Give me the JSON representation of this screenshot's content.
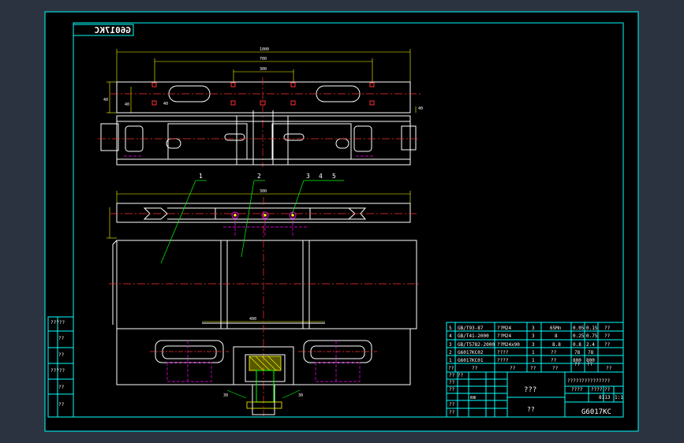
{
  "drawing": {
    "code": "G6017KC",
    "code_mirrored": "G6017KC",
    "title_cn": "???",
    "subtitle_cn": "??",
    "scale": "1:1",
    "sheet_label": "???????????????",
    "colors": {
      "background": "#000000",
      "frame": "#00ffff",
      "geometry": "#ffffff",
      "centerline": "#ff0000",
      "hidden": "#ff00ff",
      "dimension": "#ffff00",
      "leader": "#00ff00",
      "surround": "#2b3340"
    }
  },
  "dimensions": {
    "top_overall": "1000",
    "top_inner": "700",
    "top_center": "300",
    "left_a": "40",
    "left_b": "40",
    "front_width": "300",
    "bottom_width": "400",
    "bottom_angle": "30"
  },
  "leaders": [
    "1",
    "2",
    "3",
    "4",
    "5"
  ],
  "left_margin_labels": [
    "?????",
    "??",
    "??",
    "?????",
    "??",
    "??"
  ],
  "bom": {
    "rows": [
      {
        "no": "5",
        "code": "GB/T93-87",
        "name": "??M24",
        "qty": "3",
        "material": "65Mn",
        "w1": "0.05",
        "w2": "0.15",
        "note": "??"
      },
      {
        "no": "4",
        "code": "GB/T41-2000",
        "name": "??M24",
        "qty": "3",
        "material": "8",
        "w1": "0.25",
        "w2": "0.75",
        "note": "??"
      },
      {
        "no": "3",
        "code": "GB/T5782-2000",
        "name": "??M24x90",
        "qty": "3",
        "material": "8.8",
        "w1": "0.8",
        "w2": "2.4",
        "note": "??"
      },
      {
        "no": "2",
        "code": "G6017KC02",
        "name": "????",
        "qty": "1",
        "material": "??",
        "w1": "78",
        "w2": "78",
        "note": ""
      },
      {
        "no": "1",
        "code": "G6017KC01",
        "name": "????",
        "qty": "1",
        "material": "??",
        "w1": "800",
        "w2": "800",
        "note": ""
      }
    ],
    "header": {
      "no": "??",
      "code": "??",
      "name": "??",
      "qty": "??",
      "material": "??",
      "w1": "??",
      "w2": "??",
      "note": "??"
    }
  },
  "title_block": {
    "material": "???",
    "weight_label": "????",
    "mass": "????",
    "scale_label": "??",
    "scale": "1:1",
    "sheet_count": "8113",
    "designer": "?? ??",
    "unit": "??",
    "approve": "??",
    "mark_1": "mm",
    "mark_2": "??",
    "mark_3": "??"
  }
}
